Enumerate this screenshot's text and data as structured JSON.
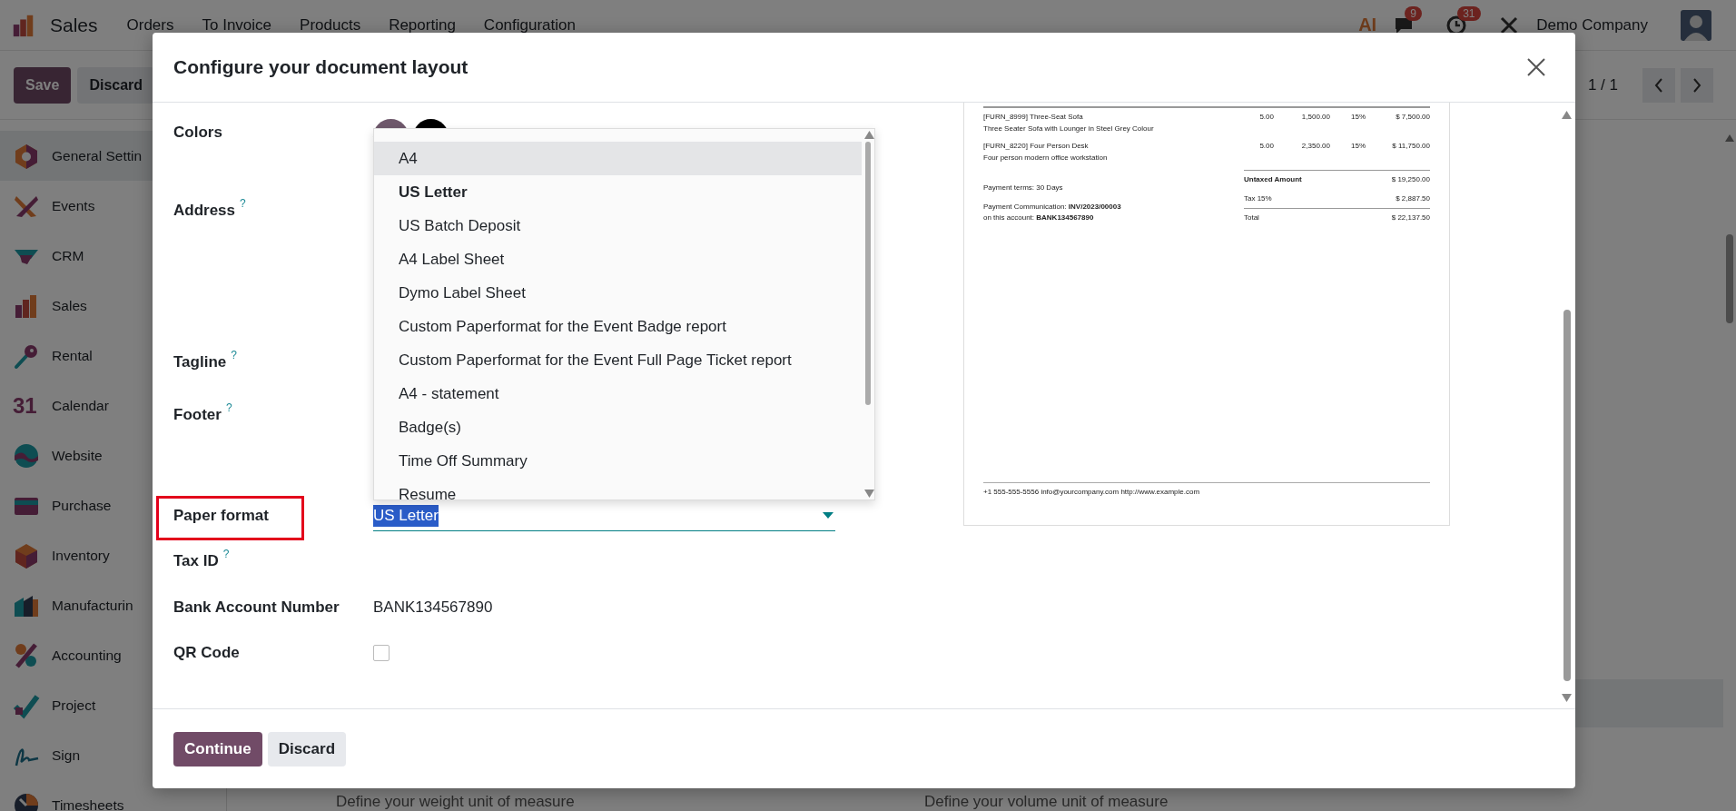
{
  "navbar": {
    "app_name": "Sales",
    "menus": [
      "Orders",
      "To Invoice",
      "Products",
      "Reporting",
      "Configuration"
    ],
    "ai_label": "AI",
    "chat_badge": "9",
    "activity_badge": "31",
    "company": "Demo Company"
  },
  "control_bar": {
    "buttons": [
      "Save",
      "Discard"
    ],
    "pager": "1 / 1"
  },
  "sidebar": {
    "items": [
      {
        "label": "General Settin",
        "selected": true
      },
      {
        "label": "Events",
        "selected": false
      },
      {
        "label": "CRM",
        "selected": false
      },
      {
        "label": "Sales",
        "selected": false
      },
      {
        "label": "Rental",
        "selected": false
      },
      {
        "label": "Calendar",
        "selected": false,
        "icon_text": "31"
      },
      {
        "label": "Website",
        "selected": false
      },
      {
        "label": "Purchase",
        "selected": false
      },
      {
        "label": "Inventory",
        "selected": false
      },
      {
        "label": "Manufacturin",
        "selected": false
      },
      {
        "label": "Accounting",
        "selected": false
      },
      {
        "label": "Project",
        "selected": false
      },
      {
        "label": "Sign",
        "selected": false
      },
      {
        "label": "Timesheets",
        "selected": false
      }
    ]
  },
  "settings_hints": [
    "Define your weight unit of measure",
    "Define your volume unit of measure"
  ],
  "dialog": {
    "title": "Configure your document layout",
    "fields": [
      {
        "label": "Colors",
        "kind": "colors",
        "swatches": [
          {
            "color": "#6e586b"
          },
          {
            "color": "#000000"
          }
        ]
      },
      {
        "label": "Address",
        "help": "?",
        "kind": "textarea"
      },
      {
        "label": "Tagline",
        "help": "?",
        "kind": "text"
      },
      {
        "label": "Footer",
        "help": "?",
        "kind": "textarea"
      },
      {
        "label": "Paper format",
        "kind": "select",
        "value": "US Letter",
        "value_selected": true,
        "annotated": true
      },
      {
        "label": "Tax ID",
        "help": "?",
        "kind": "text"
      },
      {
        "label": "Bank Account Number",
        "kind": "readonly",
        "value": "BANK134567890"
      },
      {
        "label": "QR Code",
        "kind": "checkbox",
        "checked": false
      }
    ],
    "dropdown": {
      "options": [
        {
          "label": "A4",
          "highlighted": true,
          "selected": false
        },
        {
          "label": "US Letter",
          "highlighted": false,
          "selected": true
        },
        {
          "label": "US Batch Deposit",
          "highlighted": false,
          "selected": false
        },
        {
          "label": "A4 Label Sheet",
          "highlighted": false,
          "selected": false
        },
        {
          "label": "Dymo Label Sheet",
          "highlighted": false,
          "selected": false
        },
        {
          "label": "Custom Paperformat for the Event Badge report",
          "highlighted": false,
          "selected": false
        },
        {
          "label": "Custom Paperformat for the Event Full Page Ticket report",
          "highlighted": false,
          "selected": false
        },
        {
          "label": "A4 - statement",
          "highlighted": false,
          "selected": false
        },
        {
          "label": "Badge(s)",
          "highlighted": false,
          "selected": false
        },
        {
          "label": "Time Off Summary",
          "highlighted": false,
          "selected": false
        },
        {
          "label": "Resume",
          "highlighted": false,
          "selected": false
        }
      ]
    },
    "preview": {
      "lines": [
        {
          "product": "[FURN_8999] Three-Seat Sofa",
          "description": "Three Seater Sofa with Lounger in Steel Grey Colour",
          "quantity": "5.00",
          "unit_price": "1,500.00",
          "tax": "15%",
          "amount": "$ 7,500.00"
        },
        {
          "product": "[FURN_8220] Four Person Desk",
          "description": "Four person modern office workstation",
          "quantity": "5.00",
          "unit_price": "2,350.00",
          "tax": "15%",
          "amount": "$ 11,750.00"
        }
      ],
      "payment_terms": "Payment terms: 30 Days",
      "payment_communication": "Payment Communication: **INV/2023/00003**",
      "account": "on this account: **BANK134567890**",
      "totals": [
        {
          "label": "Untaxed Amount",
          "value": "$ 19,250.00",
          "kind": "subtotal"
        },
        {
          "label": "Tax 15%",
          "value": "$ 2,887.50",
          "kind": "tax"
        },
        {
          "label": "Total",
          "value": "$ 22,137.50",
          "kind": "total"
        }
      ],
      "footer": "+1 555-555-5556 info@yourcompany.com http://www.example.com"
    },
    "buttons": [
      {
        "label": "Continue",
        "kind": "primary"
      },
      {
        "label": "Discard",
        "kind": "secondary"
      }
    ]
  }
}
